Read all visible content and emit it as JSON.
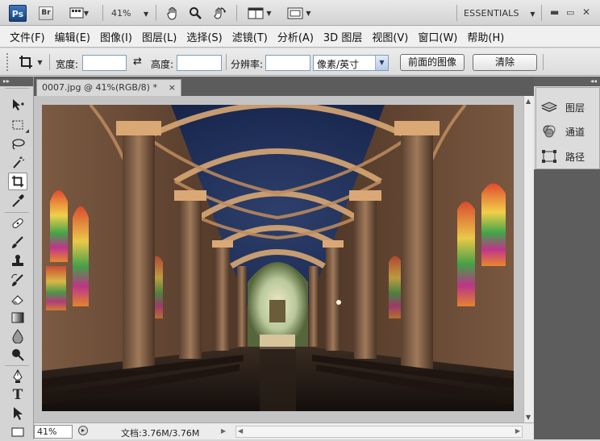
{
  "app": {
    "logo": "Ps",
    "bridge_label": "Br",
    "zoom_level": "41%",
    "workspace": "ESSENTIALS"
  },
  "menu": {
    "items": [
      "文件(F)",
      "编辑(E)",
      "图像(I)",
      "图层(L)",
      "选择(S)",
      "滤镜(T)",
      "分析(A)",
      "3D 图层",
      "视图(V)",
      "窗口(W)",
      "帮助(H)"
    ]
  },
  "options": {
    "width_label": "宽度:",
    "width_value": "",
    "height_label": "高度:",
    "height_value": "",
    "resolution_label": "分辨率:",
    "resolution_value": "",
    "unit_selected": "像素/英寸",
    "front_image_button": "前面的图像",
    "clear_button": "清除"
  },
  "document": {
    "tab_title": "0007.jpg @ 41%(RGB/8) *",
    "close_glyph": "×"
  },
  "status": {
    "zoom": "41%",
    "doc_info": "文档:3.76M/3.76M"
  },
  "panels": {
    "items": [
      {
        "label": "图层",
        "icon": "layers-icon"
      },
      {
        "label": "通道",
        "icon": "channels-icon"
      },
      {
        "label": "路径",
        "icon": "paths-icon"
      }
    ]
  },
  "tools": [
    "move-tool-icon",
    "marquee-tool-icon",
    "lasso-tool-icon",
    "magic-wand-tool-icon",
    "crop-tool-icon",
    "eyedropper-tool-icon",
    "healing-brush-tool-icon",
    "brush-tool-icon",
    "clone-stamp-tool-icon",
    "history-brush-tool-icon",
    "eraser-tool-icon",
    "gradient-tool-icon",
    "blur-tool-icon",
    "dodge-tool-icon",
    "pen-tool-icon",
    "type-tool-icon",
    "path-selection-tool-icon"
  ],
  "colors": {
    "photo_vault": "#1b2a52",
    "photo_arches": "#c99a6a",
    "panel_dark": "#5f5f5f"
  }
}
